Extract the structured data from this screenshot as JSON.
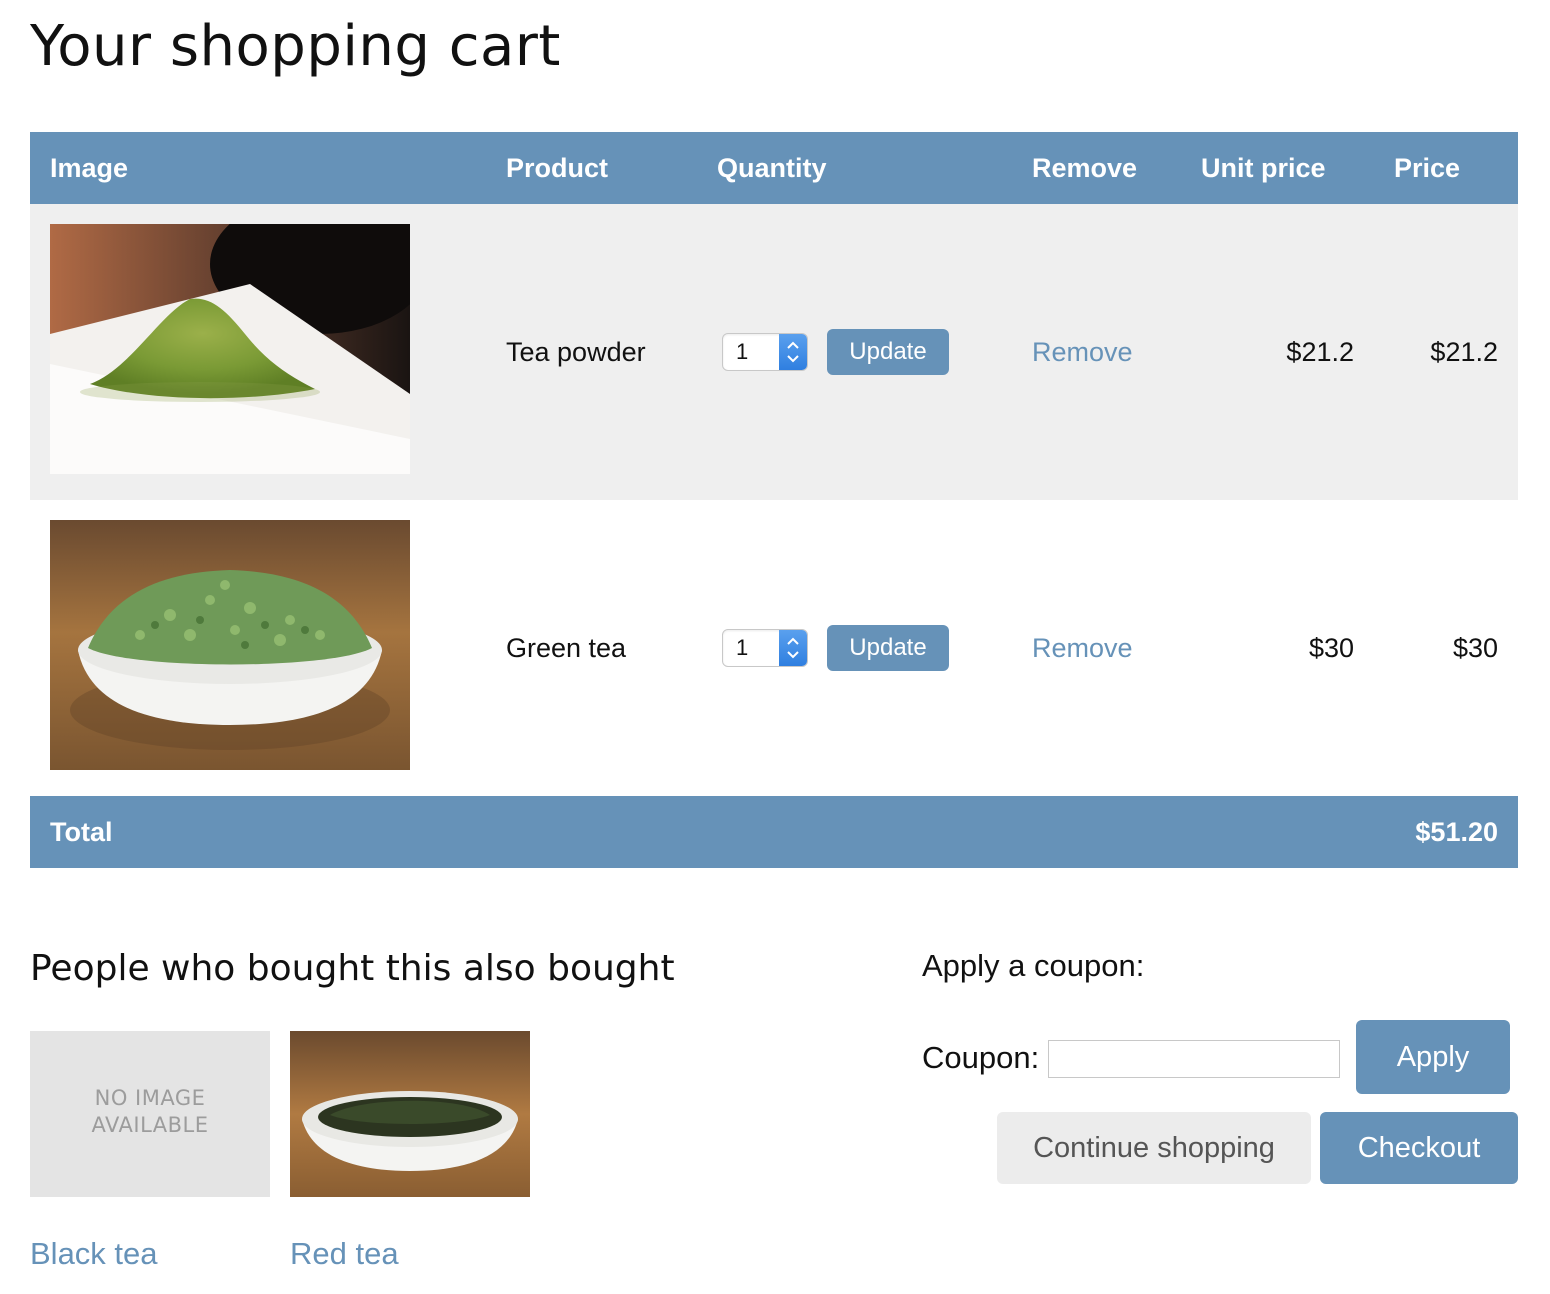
{
  "page": {
    "title": "Your shopping cart"
  },
  "colors": {
    "accent": "#6692b8",
    "row_alt": "#efefef",
    "link": "#6692b8"
  },
  "cart": {
    "headers": {
      "image": "Image",
      "product": "Product",
      "quantity": "Quantity",
      "remove": "Remove",
      "unit_price": "Unit price",
      "price": "Price"
    },
    "items": [
      {
        "image": "matcha-powder-photo",
        "product": "Tea powder",
        "quantity": "1",
        "update_label": "Update",
        "remove_label": "Remove",
        "unit_price": "$21.2",
        "price": "$21.2"
      },
      {
        "image": "green-tea-bowl-photo",
        "product": "Green tea",
        "quantity": "1",
        "update_label": "Update",
        "remove_label": "Remove",
        "unit_price": "$30",
        "price": "$30"
      }
    ],
    "total_label": "Total",
    "total_value": "$51.20"
  },
  "recommendations": {
    "title": "People who bought this also bought",
    "items": [
      {
        "name": "Black tea",
        "image": "no-image-placeholder",
        "placeholder_line1": "NO IMAGE",
        "placeholder_line2": "AVAILABLE"
      },
      {
        "name": "Red tea",
        "image": "red-tea-bowl-photo"
      }
    ]
  },
  "coupon": {
    "heading": "Apply a coupon:",
    "label": "Coupon:",
    "value": "",
    "apply_label": "Apply"
  },
  "actions": {
    "continue_label": "Continue shopping",
    "checkout_label": "Checkout"
  }
}
